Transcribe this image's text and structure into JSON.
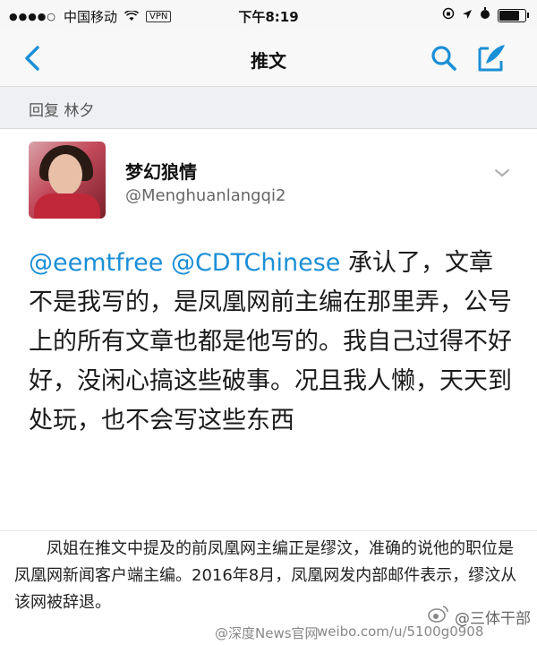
{
  "status_bar": {
    "carrier": "中国移动",
    "vpn": "VPN",
    "time": "下午8:19",
    "battery_level": 0.85
  },
  "nav": {
    "title": "推文"
  },
  "reply": {
    "text": "回复 林夕"
  },
  "author": {
    "display_name": "梦幻狼情",
    "handle": "@Menghuanlangqi2"
  },
  "tweet": {
    "mention_1": "@eemtfree",
    "mention_2": "@CDTChinese",
    "body": "承认了，文章不是我写的，是凤凰网前主编在那里弄，公号上的所有文章也都是他写的。我自己过得不好好，没闲心搞这些破事。况且我人懒，天天到处玩，也不会写这些东西"
  },
  "article": {
    "text": "凤姐在推文中提及的前凤凰网主编正是缪汶，准确的说他的职位是凤凰网新闻客户端主编。2016年8月，凤凰网发内部邮件表示，缪汶从该网被辞退。"
  },
  "watermark": {
    "left": "@深度News官网",
    "middle": "weibo.com/u/5100g0908",
    "brand": "@三体干部"
  },
  "colors": {
    "accent": "#1b8fd6",
    "nav_bg": "#f8f8f8",
    "reply_bg": "#eef0f3"
  }
}
